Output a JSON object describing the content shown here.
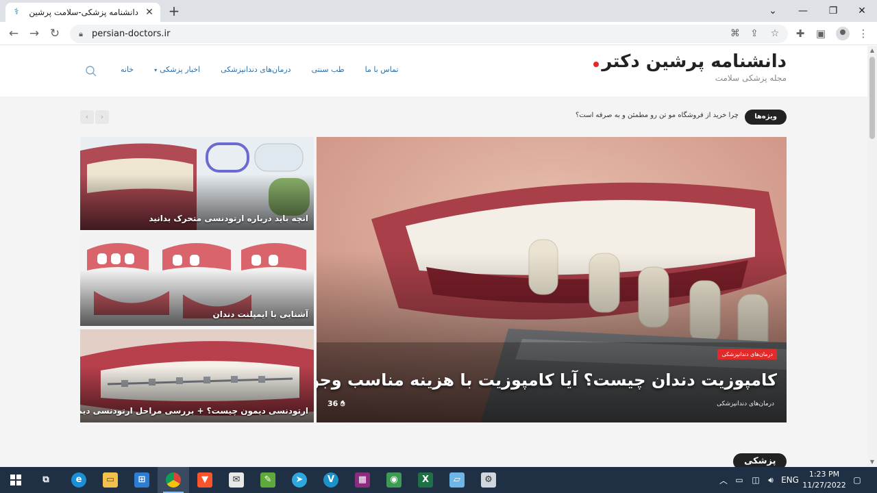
{
  "browser": {
    "tab_title": "دانشنامه پزشکی-سلامت پرشین دکتر",
    "url": "persian-doctors.ir"
  },
  "site": {
    "logo_name": "دانشنامه پرشین دکتر",
    "tagline": "مجله پزشکی سلامت",
    "nav": [
      {
        "label": "خانه"
      },
      {
        "label": "اخبار پزشکی",
        "caret": "▾"
      },
      {
        "label": "درمان‌های دندانپزشکی"
      },
      {
        "label": "طب سنتی"
      },
      {
        "label": "تماس با ما"
      }
    ]
  },
  "ticker": {
    "label": "ویژه‌ها",
    "text": "چرا خرید از فروشگاه مو تن رو مطمئن و به صرفه است؟",
    "prev": "‹",
    "next": "›"
  },
  "featured": {
    "category_badge": "درمان‌های دندانپزشکی",
    "headline": "کامپوزیت دندان چیست؟ آیا کامپوزیت با هزینه مناسب وجود دارد؟",
    "meta_category": "درمان‌های دندانپزشکی",
    "likes": "36"
  },
  "side_posts": [
    {
      "title": "انچه باید درباره ارتودنسی متحرک بدانید"
    },
    {
      "title": "آشنایی با ایمپلنت دندان"
    },
    {
      "title": "ارتودنسی دیمون چیست؟ + بررسی مراحل ارتودنسی دیمون"
    }
  ],
  "section_title": "پزشکی",
  "taskbar": {
    "time": "1:23 PM",
    "date": "11/27/2022",
    "lang": "ENG"
  },
  "colors": {
    "accent_red": "#e32a2a",
    "nav_link": "#2c6fa8",
    "taskbar": "#1f2f44"
  }
}
